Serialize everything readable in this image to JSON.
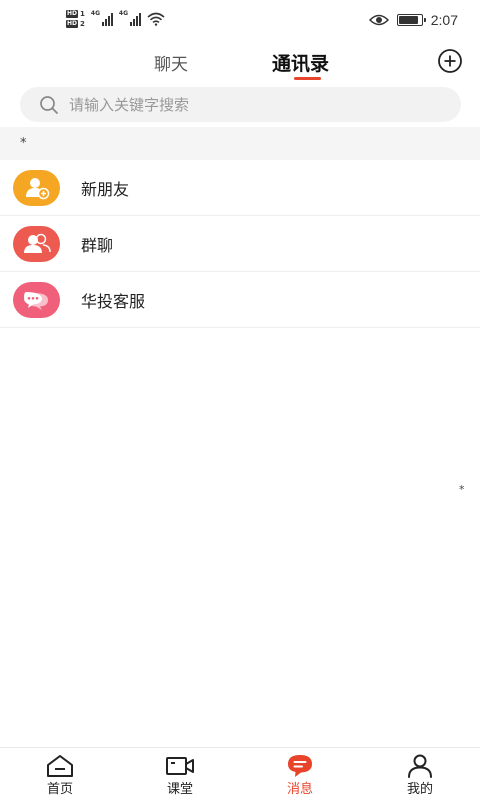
{
  "status_bar": {
    "sim1": "HD",
    "sim1_num": "1",
    "sim2": "HD",
    "sim2_num": "2",
    "network1": "4G",
    "network2": "4G",
    "time": "2:07",
    "battery_level": 0.9,
    "icons": [
      "hd-icon",
      "signal-icon",
      "wifi-icon",
      "eye-icon",
      "battery-icon"
    ]
  },
  "header": {
    "tabs": [
      {
        "label": "聊天",
        "active": false
      },
      {
        "label": "通讯录",
        "active": true
      }
    ],
    "add_icon": "plus-circle-icon"
  },
  "search": {
    "placeholder": "请输入关键字搜索",
    "value": ""
  },
  "index_header": "*",
  "contacts": [
    {
      "label": "新朋友",
      "icon": "add-friend-icon",
      "color": "#f5a623"
    },
    {
      "label": "群聊",
      "icon": "group-icon",
      "color": "#ec5a50"
    },
    {
      "label": "华投客服",
      "icon": "chat-bubble-icon",
      "color": "#f0607a"
    }
  ],
  "side_index": "*",
  "bottom_nav": [
    {
      "label": "首页",
      "icon": "home-icon",
      "active": false
    },
    {
      "label": "课堂",
      "icon": "video-icon",
      "active": false
    },
    {
      "label": "消息",
      "icon": "message-icon",
      "active": true
    },
    {
      "label": "我的",
      "icon": "profile-icon",
      "active": false
    }
  ],
  "colors": {
    "accent": "#e8432b",
    "search_bg": "#f2f2f2",
    "section_bg": "#f5f5f5"
  }
}
